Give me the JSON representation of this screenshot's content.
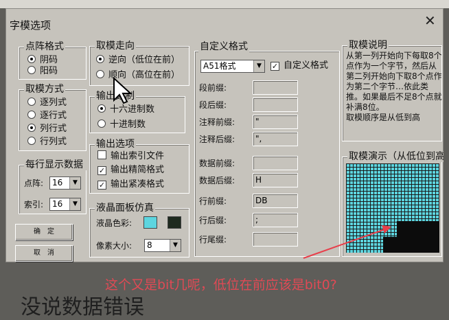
{
  "window": {
    "title": "字模选项",
    "close_glyph": "✕"
  },
  "dot_format": {
    "label": "点阵格式",
    "options": [
      "阴码",
      "阳码"
    ],
    "selected": 0
  },
  "scan_mode": {
    "label": "取模方式",
    "options": [
      "逐列式",
      "逐行式",
      "列行式",
      "行列式"
    ],
    "selected": 2
  },
  "per_line": {
    "label": "每行显示数据",
    "dot_label": "点阵:",
    "dot_value": "16",
    "index_label": "索引:",
    "index_value": "16"
  },
  "buttons": {
    "ok": "确　定",
    "cancel": "取　消"
  },
  "direction": {
    "label": "取模走向",
    "options": [
      "逆向（低位在前）",
      "顺向（高位在前）"
    ],
    "selected": 0
  },
  "output_base": {
    "label": "输出数制",
    "options": [
      "十六进制数",
      "十进制数"
    ],
    "selected": 0
  },
  "output_opts": {
    "label": "输出选项",
    "items": [
      {
        "text": "输出索引文件",
        "checked": false
      },
      {
        "text": "输出精简格式",
        "checked": true
      },
      {
        "text": "输出紧凑格式",
        "checked": true
      }
    ]
  },
  "lcd": {
    "label": "液晶面板仿真",
    "color_label": "液晶色彩:",
    "pixel_label": "像素大小:",
    "pixel_value": "8",
    "color_a": "#5dd5df",
    "color_b": "#1e2a1e"
  },
  "custom": {
    "label": "自定义格式",
    "format_value": "A51格式",
    "checkbox_label": "自定义格式",
    "checked": true,
    "fields": [
      {
        "label": "段前缀:",
        "value": ""
      },
      {
        "label": "段后缀:",
        "value": ""
      },
      {
        "label": "注释前缀:",
        "value": "\""
      },
      {
        "label": "注释后缀:",
        "value": "\","
      },
      {
        "label": "数据前缀:",
        "value": ""
      },
      {
        "label": "数据后缀:",
        "value": "H"
      },
      {
        "label": "行前缀:",
        "value": "DB"
      },
      {
        "label": "行后缀:",
        "value": ";"
      },
      {
        "label": "行尾缀:",
        "value": ""
      }
    ]
  },
  "desc": {
    "label": "取模说明",
    "text": "从第一列开始向下每取8个点作为一个字节，然后从第二列开始向下取8个点作为第二个字节…依此类推。如果最后不足8个点就补满8位。",
    "order": "取模顺序是从低到高"
  },
  "demo": {
    "label": "取模演示（从低位到高位）"
  },
  "annotation": "这个又是bit几呢，低位在前应该是bit0?",
  "bottom_text": "没说数据错误"
}
